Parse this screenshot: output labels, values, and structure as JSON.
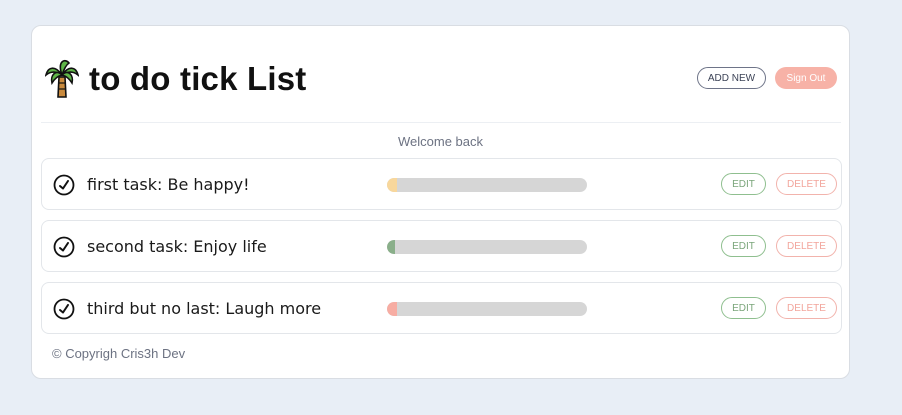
{
  "app": {
    "title": "to do tick List",
    "logo_icon": "palm-tree-icon"
  },
  "header": {
    "add_new_label": "ADD NEW",
    "sign_out_label": "Sign Out"
  },
  "welcome_text": "Welcome back",
  "tasks": [
    {
      "text": "first task: Be happy!",
      "progress": 0.05,
      "color": "#f8d79c",
      "edit_label": "EDIT",
      "delete_label": "DELETE"
    },
    {
      "text": "second task: Enjoy life",
      "progress": 0.04,
      "color": "#8aaf8a",
      "edit_label": "EDIT",
      "delete_label": "DELETE"
    },
    {
      "text": "third but no last: Laugh more",
      "progress": 0.05,
      "color": "#f7ada3",
      "edit_label": "EDIT",
      "delete_label": "DELETE"
    }
  ],
  "footer": {
    "copyright": "© Copyrigh Cris3h Dev"
  },
  "colors": {
    "background": "#e8eef6",
    "sign_out": "#f7b2a7",
    "edit": "#7aa57a",
    "delete": "#f2a59c"
  }
}
